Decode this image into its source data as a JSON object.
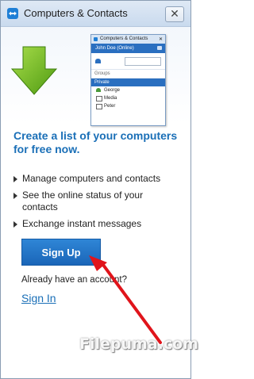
{
  "window": {
    "title": "Computers & Contacts",
    "close_label": "✕"
  },
  "preview": {
    "title": "Computers & Contacts",
    "user": "John Doe (Online)",
    "group_all": "Groups",
    "group_selected": "Private",
    "items": [
      "George",
      "Media",
      "Peter"
    ]
  },
  "main": {
    "headline": "Create a list of your computers for free now.",
    "features": [
      "Manage computers and contacts",
      "See the online status of your contacts",
      "Exchange instant messages"
    ],
    "signup_label": "Sign Up",
    "account_prompt": "Already have an account?",
    "signin_label": "Sign In"
  },
  "watermark": "Filepuma.com",
  "colors": {
    "accent": "#1a6fb7",
    "button": "#1f78c9",
    "annotation_arrow": "#e0141b",
    "graphic_arrow": "#6dbb1e"
  }
}
